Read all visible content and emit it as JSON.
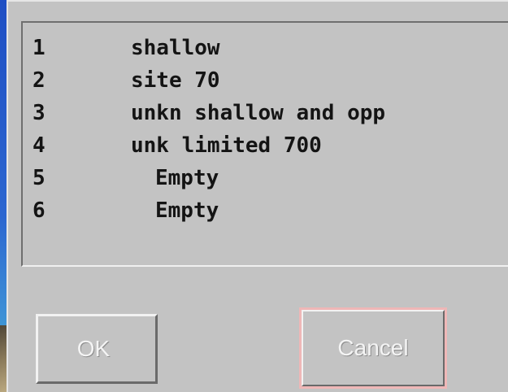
{
  "list": {
    "items": [
      {
        "num": "1",
        "name": "shallow"
      },
      {
        "num": "2",
        "name": "site 70"
      },
      {
        "num": "3",
        "name": "unkn shallow and opp"
      },
      {
        "num": "4",
        "name": "unk limited 700"
      },
      {
        "num": "5",
        "name": "Empty"
      },
      {
        "num": "6",
        "name": "Empty"
      }
    ]
  },
  "buttons": {
    "ok_label": "OK",
    "cancel_label": "Cancel"
  },
  "colors": {
    "dialog_bg": "#c3c3c3",
    "desktop_bg": "#2c66d0",
    "cancel_focus": "#efb7b7"
  }
}
